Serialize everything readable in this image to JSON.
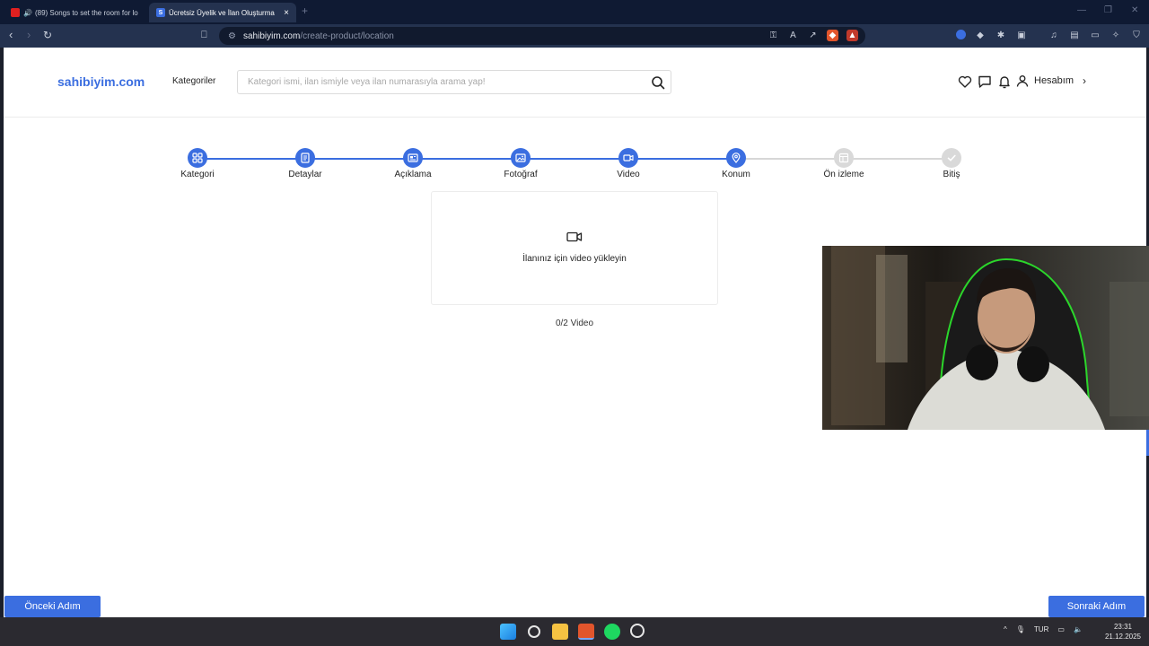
{
  "browser": {
    "tabs": [
      {
        "title": "(89) Songs to set the room for lo"
      },
      {
        "title": "Ücretsiz Üyelik ve İlan Oluşturma"
      }
    ],
    "new_tab": "+",
    "url_host": "sahibiyim.com",
    "url_path": "/create-product/location"
  },
  "header": {
    "logo": "sahibiyim.com",
    "categories_label": "Kategoriler",
    "search_placeholder": "Kategori ismi, ilan ismiyle veya ilan numarasıyla arama yap!",
    "account_label": "Hesabım"
  },
  "stepper": {
    "steps": [
      {
        "label": "Kategori",
        "state": "done",
        "icon": "grid-icon"
      },
      {
        "label": "Detaylar",
        "state": "done",
        "icon": "document-icon"
      },
      {
        "label": "Açıklama",
        "state": "done",
        "icon": "newspaper-icon"
      },
      {
        "label": "Fotoğraf",
        "state": "done",
        "icon": "image-icon"
      },
      {
        "label": "Video",
        "state": "done",
        "icon": "video-icon"
      },
      {
        "label": "Konum",
        "state": "current",
        "icon": "location-icon"
      },
      {
        "label": "Ön izleme",
        "state": "todo",
        "icon": "layout-icon"
      },
      {
        "label": "Bitiş",
        "state": "todo",
        "icon": "check-icon"
      }
    ]
  },
  "upload": {
    "prompt": "İlanınız için video yükleyin",
    "count": "0/2 Video"
  },
  "footer": {
    "prev_label": "Önceki Adım",
    "next_label": "Sonraki Adım"
  },
  "taskbar": {
    "language": "TUR",
    "time": "23:31",
    "date": "21.12.2025"
  },
  "colors": {
    "accent": "#3b6ee0",
    "inactive_step": "#d9d9d9"
  }
}
